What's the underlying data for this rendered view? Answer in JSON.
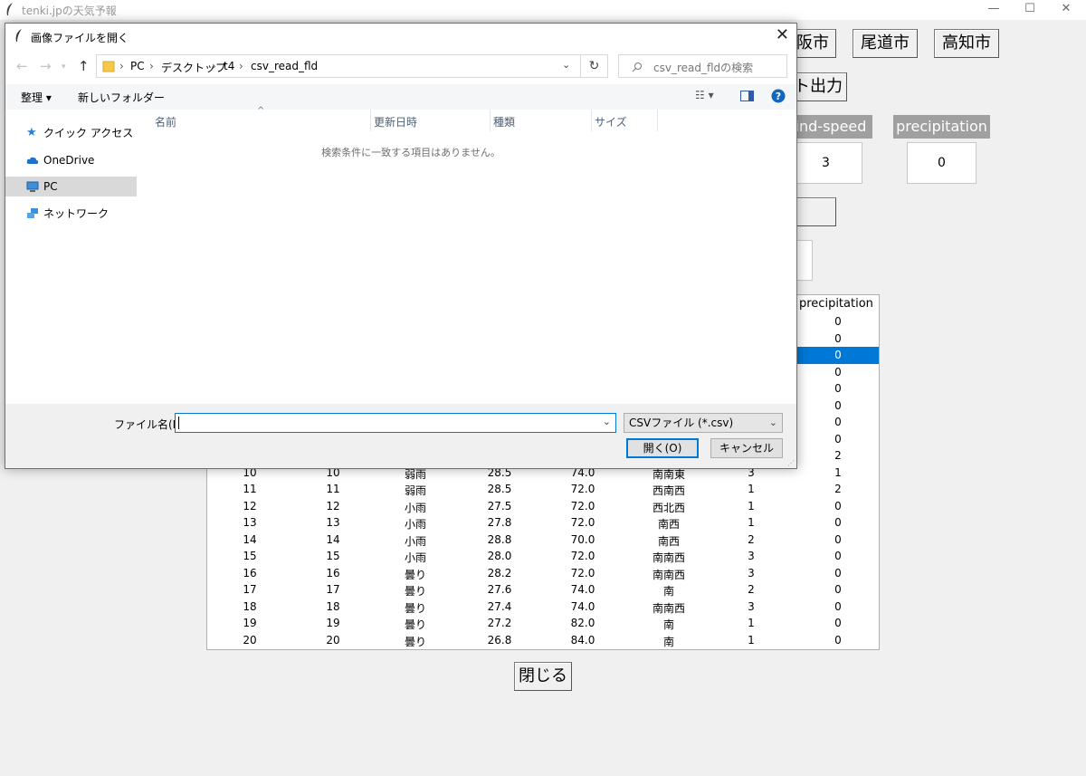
{
  "window": {
    "title": "tenki.jpの天気予報",
    "minimize": "—",
    "maximize": "☐",
    "close": "✕"
  },
  "cities": [
    "阪市",
    "尾道市",
    "高知市"
  ],
  "export_button": "ト出力",
  "headers": {
    "wind_speed": "ind-speed",
    "precipitation": "precipitation"
  },
  "entries": {
    "wind_speed": "3",
    "precipitation": "0"
  },
  "close_button": "閉じる",
  "table": {
    "header_precipitation": "precipitation",
    "partial_rows": [
      "0",
      "0",
      "0",
      "0",
      "0",
      "0",
      "0",
      "0",
      "2"
    ],
    "selected_index": 2,
    "rows": [
      [
        "10",
        "10",
        "弱雨",
        "28.5",
        "74.0",
        "南南東",
        "3",
        "1"
      ],
      [
        "11",
        "11",
        "弱雨",
        "28.5",
        "72.0",
        "西南西",
        "1",
        "2"
      ],
      [
        "12",
        "12",
        "小雨",
        "27.5",
        "72.0",
        "西北西",
        "1",
        "0"
      ],
      [
        "13",
        "13",
        "小雨",
        "27.8",
        "72.0",
        "南西",
        "1",
        "0"
      ],
      [
        "14",
        "14",
        "小雨",
        "28.8",
        "70.0",
        "南西",
        "2",
        "0"
      ],
      [
        "15",
        "15",
        "小雨",
        "28.0",
        "72.0",
        "南南西",
        "3",
        "0"
      ],
      [
        "16",
        "16",
        "曇り",
        "28.2",
        "72.0",
        "南南西",
        "3",
        "0"
      ],
      [
        "17",
        "17",
        "曇り",
        "27.6",
        "74.0",
        "南",
        "2",
        "0"
      ],
      [
        "18",
        "18",
        "曇り",
        "27.4",
        "74.0",
        "南南西",
        "3",
        "0"
      ],
      [
        "19",
        "19",
        "曇り",
        "27.2",
        "82.0",
        "南",
        "1",
        "0"
      ],
      [
        "20",
        "20",
        "曇り",
        "26.8",
        "84.0",
        "南",
        "1",
        "0"
      ]
    ]
  },
  "dialog": {
    "title": "画像ファイルを開く",
    "breadcrumb": [
      "PC",
      "デスクトップ",
      "t4",
      "csv_read_fld"
    ],
    "search_placeholder": "csv_read_fldの検索",
    "organize": "整理 ▾",
    "new_folder": "新しいフォルダー",
    "sidebar": [
      "クイック アクセス",
      "OneDrive",
      "PC",
      "ネットワーク"
    ],
    "sidebar_selected": 2,
    "columns": [
      "名前",
      "更新日時",
      "種類",
      "サイズ"
    ],
    "empty_message": "検索条件に一致する項目はありません。",
    "filename_label": "ファイル名(N):",
    "filename_value": "",
    "filetype": "CSVファイル (*.csv)",
    "open_button": "開く(O)",
    "cancel_button": "キャンセル"
  }
}
